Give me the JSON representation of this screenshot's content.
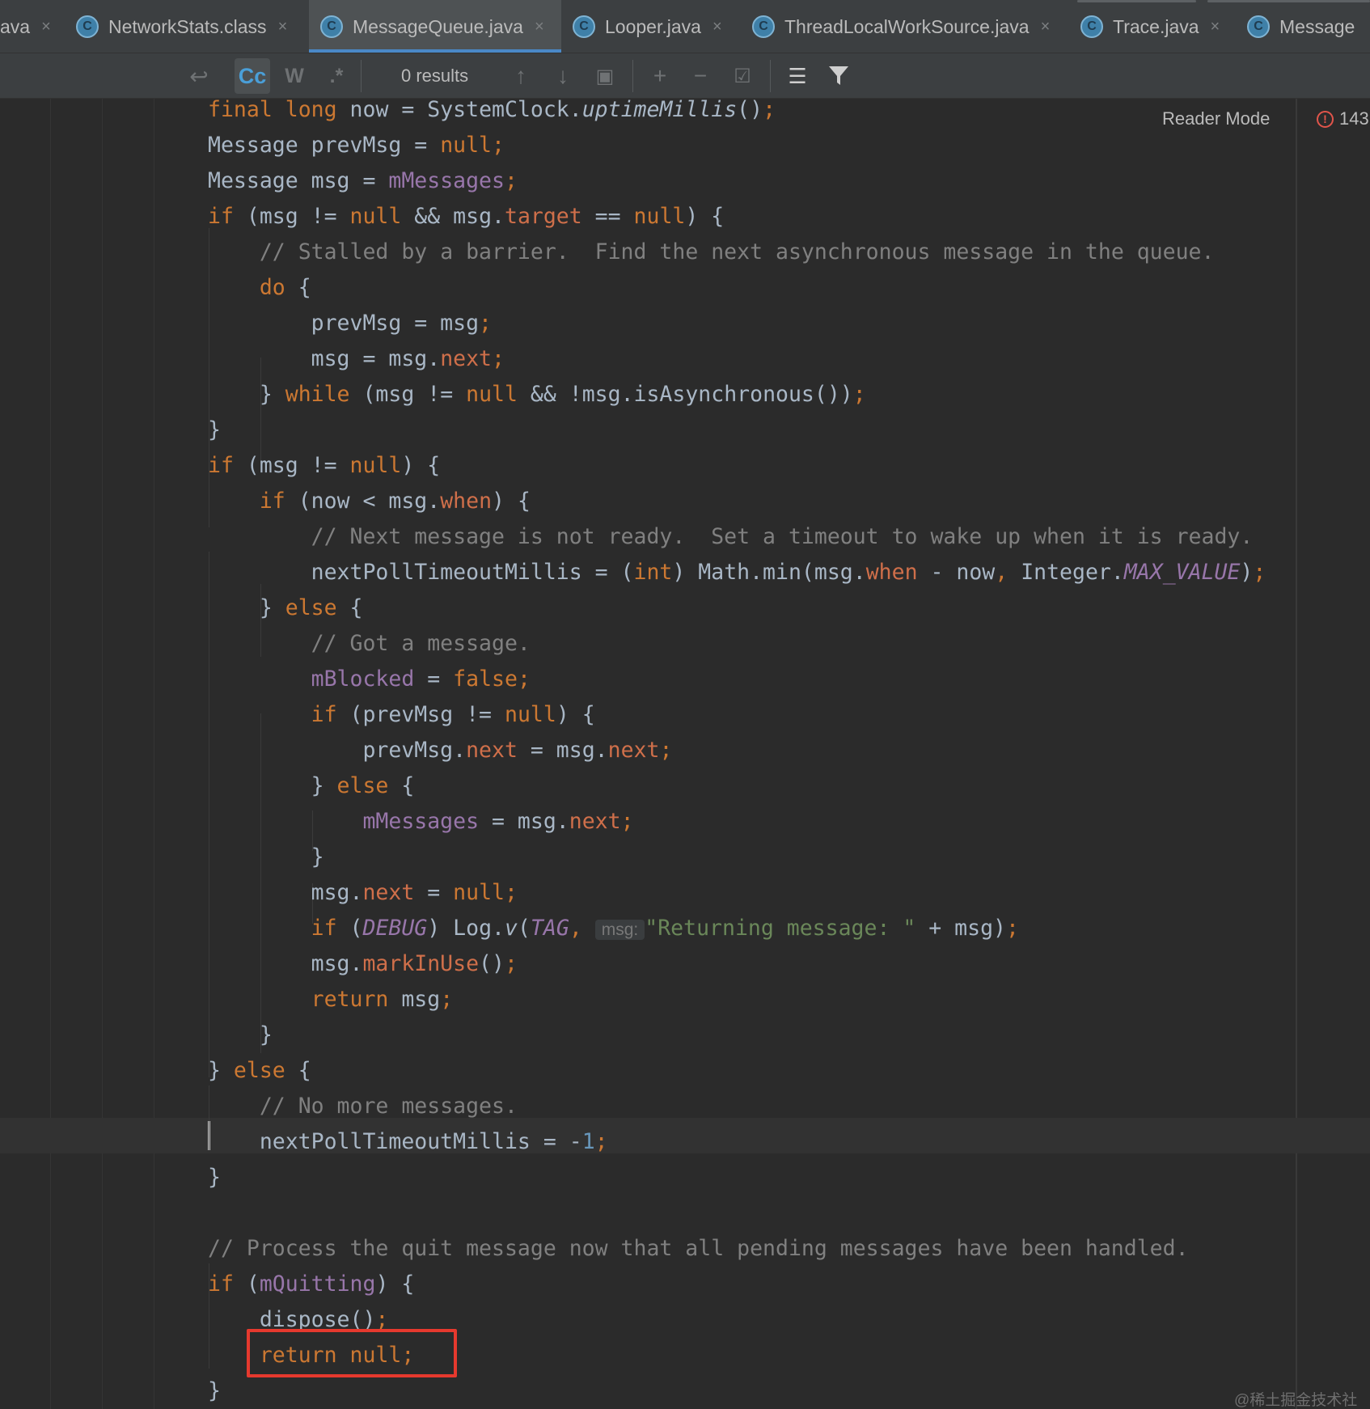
{
  "tabs": [
    {
      "label": "ava",
      "icon": "",
      "active": false
    },
    {
      "label": "NetworkStats.class",
      "icon": "C",
      "active": false
    },
    {
      "label": "MessageQueue.java",
      "icon": "C",
      "active": true
    },
    {
      "label": "Looper.java",
      "icon": "C",
      "active": false
    },
    {
      "label": "ThreadLocalWorkSource.java",
      "icon": "C",
      "active": false
    },
    {
      "label": "Trace.java",
      "icon": "C",
      "active": false
    },
    {
      "label": "Message",
      "icon": "C",
      "active": false
    }
  ],
  "tab_close_glyph": "×",
  "find": {
    "results": "0 results",
    "cc_label": "Cc",
    "w_label": "W",
    "regex_label": ".*"
  },
  "editor": {
    "reader_mode": "Reader Mode",
    "error_count": "143",
    "param_hint": "msg:",
    "lines": [
      "final long now = SystemClock.uptimeMillis();",
      "Message prevMsg = null;",
      "Message msg = mMessages;",
      "if (msg != null && msg.target == null) {",
      "    // Stalled by a barrier.  Find the next asynchronous message in the queue.",
      "    do {",
      "        prevMsg = msg;",
      "        msg = msg.next;",
      "    } while (msg != null && !msg.isAsynchronous());",
      "}",
      "if (msg != null) {",
      "    if (now < msg.when) {",
      "        // Next message is not ready.  Set a timeout to wake up when it is ready.",
      "        nextPollTimeoutMillis = (int) Math.min(msg.when - now, Integer.MAX_VALUE);",
      "    } else {",
      "        // Got a message.",
      "        mBlocked = false;",
      "        if (prevMsg != null) {",
      "            prevMsg.next = msg.next;",
      "        } else {",
      "            mMessages = msg.next;",
      "        }",
      "        msg.next = null;",
      "        if (DEBUG) Log.v(TAG, \"Returning message: \" + msg);",
      "        msg.markInUse();",
      "        return msg;",
      "    }",
      "} else {",
      "    // No more messages.",
      "    nextPollTimeoutMillis = -1;",
      "}",
      "",
      "// Process the quit message now that all pending messages have been handled.",
      "if (mQuitting) {",
      "    dispose();",
      "    return null;",
      "}"
    ],
    "highlighted_line": "return null;"
  },
  "watermark": "@稀土掘金技术社区",
  "colors": {
    "keyword": "#cc7832",
    "field": "#9876aa",
    "member": "#cf6f4a",
    "comment": "#808080",
    "string": "#6a8759",
    "number": "#6897bb",
    "highlight_box": "#e6392e",
    "tab_underline": "#4a88c7"
  }
}
